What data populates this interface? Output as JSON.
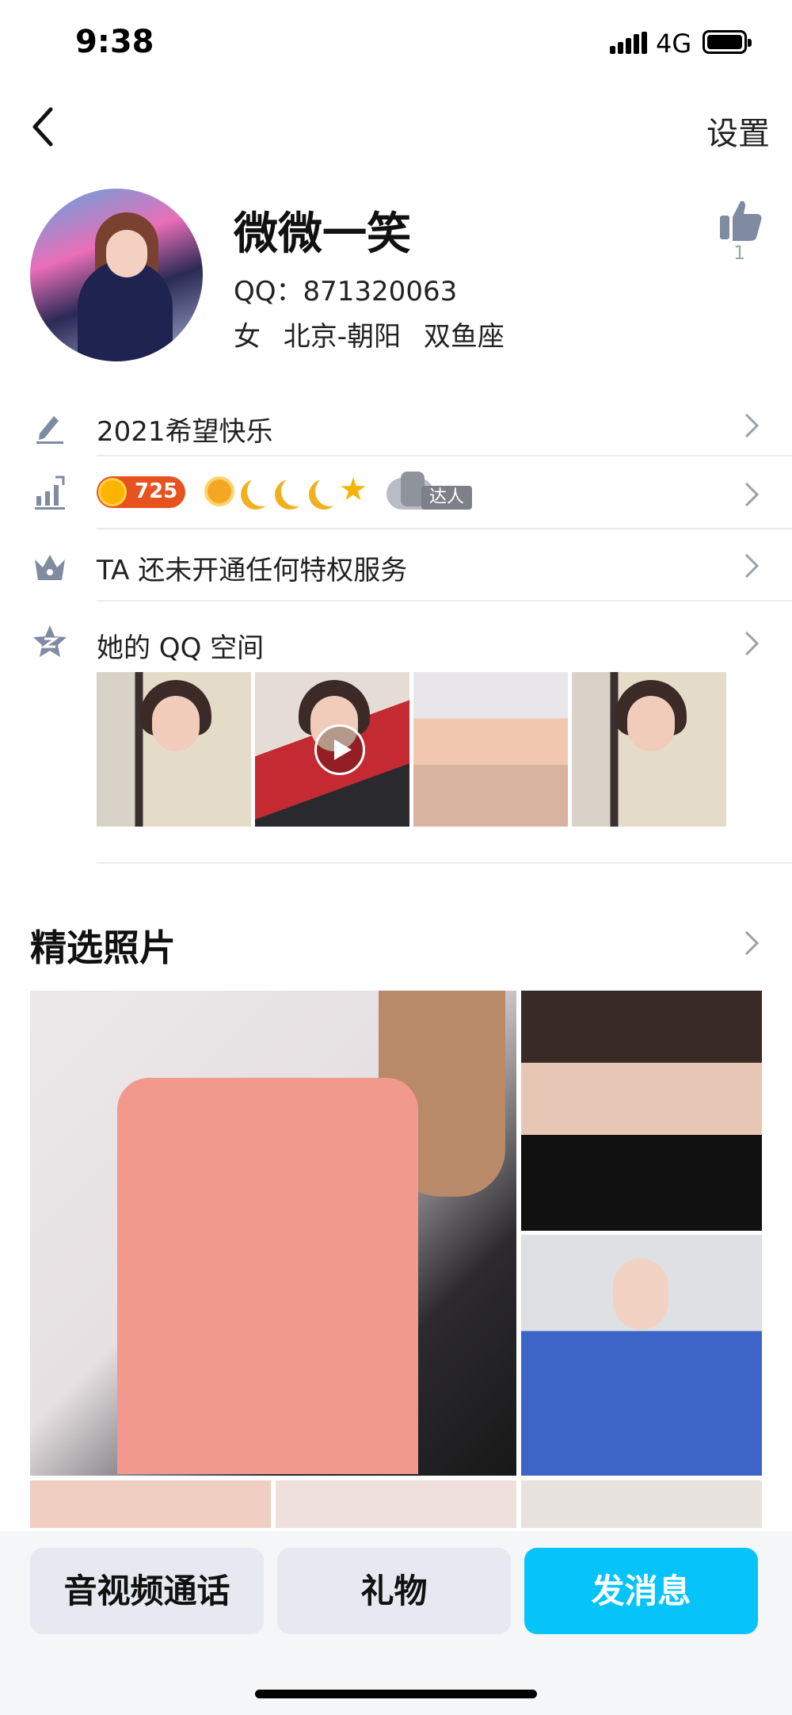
{
  "status_bar": {
    "time": "9:38",
    "network": "4G"
  },
  "nav": {
    "settings_label": "设置"
  },
  "profile": {
    "name": "微微一笑",
    "qq_line": "QQ：871320063",
    "meta_line": "女  北京-朝阳  双鱼座",
    "like_count": "1"
  },
  "rows": {
    "signature": "2021希望快乐",
    "level_coin": "725",
    "talent_label": "达人",
    "privilege": "TA 还未开通任何特权服务",
    "qzone": "她的 QQ 空间"
  },
  "featured": {
    "title": "精选照片"
  },
  "actions": {
    "call": "音视频通话",
    "gift": "礼物",
    "message": "发消息"
  },
  "colors": {
    "accent": "#06c4fa",
    "coin": "#e8521e",
    "secondary_button": "#e6e9f0"
  }
}
